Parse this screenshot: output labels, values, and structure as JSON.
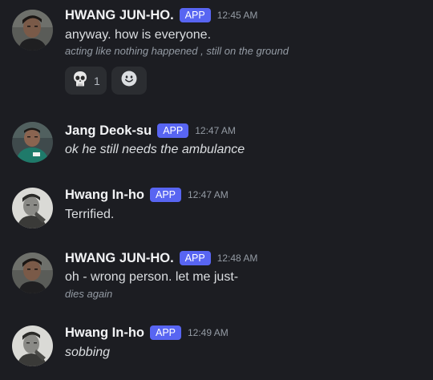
{
  "messages": [
    {
      "author": "HWANG JUN-HO.",
      "badge": "APP",
      "time": "12:45 AM",
      "text": "anyway. how is everyone.",
      "subtext": "acting like nothing happened , still on the ground",
      "avatar": "avatar-junho"
    },
    {
      "author": "Jang Deok-su",
      "badge": "APP",
      "time": "12:47 AM",
      "text": "ok he still needs the ambulance",
      "avatar": "avatar-deoksu"
    },
    {
      "author": "Hwang In-ho",
      "badge": "APP",
      "time": "12:47 AM",
      "text": "Terrified.",
      "avatar": "avatar-inho"
    },
    {
      "author": "HWANG JUN-HO.",
      "badge": "APP",
      "time": "12:48 AM",
      "text": "oh - wrong person. let me just-",
      "subtext": "dies again",
      "avatar": "avatar-junho"
    },
    {
      "author": "Hwang In-ho",
      "badge": "APP",
      "time": "12:49 AM",
      "text": "sobbing",
      "avatar": "avatar-inho"
    }
  ],
  "reactions": {
    "skull": {
      "icon": "skull-emoji",
      "count": "1"
    },
    "add": {
      "icon": "add-reaction-smiley-icon"
    }
  },
  "colors": {
    "background": "#1c1d22",
    "badge": "#5865f2",
    "reaction_bg": "#2b2d31",
    "muted": "#949ba4"
  }
}
